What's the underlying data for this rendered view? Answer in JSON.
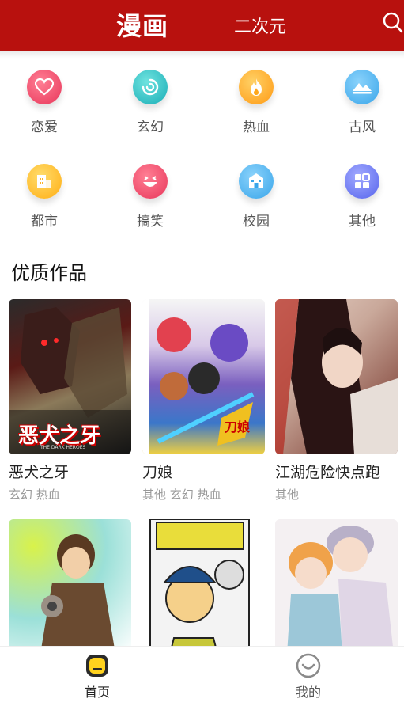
{
  "header": {
    "tab_primary": "漫画",
    "tab_secondary": "二次元",
    "search_icon": "search-icon"
  },
  "categories": [
    {
      "label": "恋爱",
      "icon": "heart-icon",
      "color": "#ef4d69"
    },
    {
      "label": "玄幻",
      "icon": "swirl-icon",
      "color": "#2ec3c7"
    },
    {
      "label": "热血",
      "icon": "flame-icon",
      "color": "#ffae24"
    },
    {
      "label": "古风",
      "icon": "landscape-icon",
      "color": "#4cb6ee"
    },
    {
      "label": "都市",
      "icon": "building-icon",
      "color": "#ffbc2c"
    },
    {
      "label": "搞笑",
      "icon": "laugh-icon",
      "color": "#ef4d69"
    },
    {
      "label": "校园",
      "icon": "school-icon",
      "color": "#4cb6ee"
    },
    {
      "label": "其他",
      "icon": "grid-icon",
      "color": "#6d7cf0"
    }
  ],
  "section": {
    "title": "优质作品"
  },
  "comics": [
    {
      "title": "恶犬之牙",
      "tags": "玄幻 热血",
      "cover_text": "恶犬之牙",
      "cover_sub": "THE DARK HEROES"
    },
    {
      "title": "刀娘",
      "tags": "其他 玄幻 热血",
      "cover_text": "刀娘"
    },
    {
      "title": "江湖危险快点跑",
      "tags": "其他"
    },
    {
      "title": "",
      "tags": ""
    },
    {
      "title": "",
      "tags": ""
    },
    {
      "title": "",
      "tags": ""
    }
  ],
  "bottom_nav": [
    {
      "label": "首页",
      "icon": "home-face-icon",
      "active": true
    },
    {
      "label": "我的",
      "icon": "smile-icon",
      "active": false
    }
  ],
  "colors": {
    "brand": "#b8110e",
    "tag_gray": "#999999",
    "nav_active": "#222222"
  }
}
